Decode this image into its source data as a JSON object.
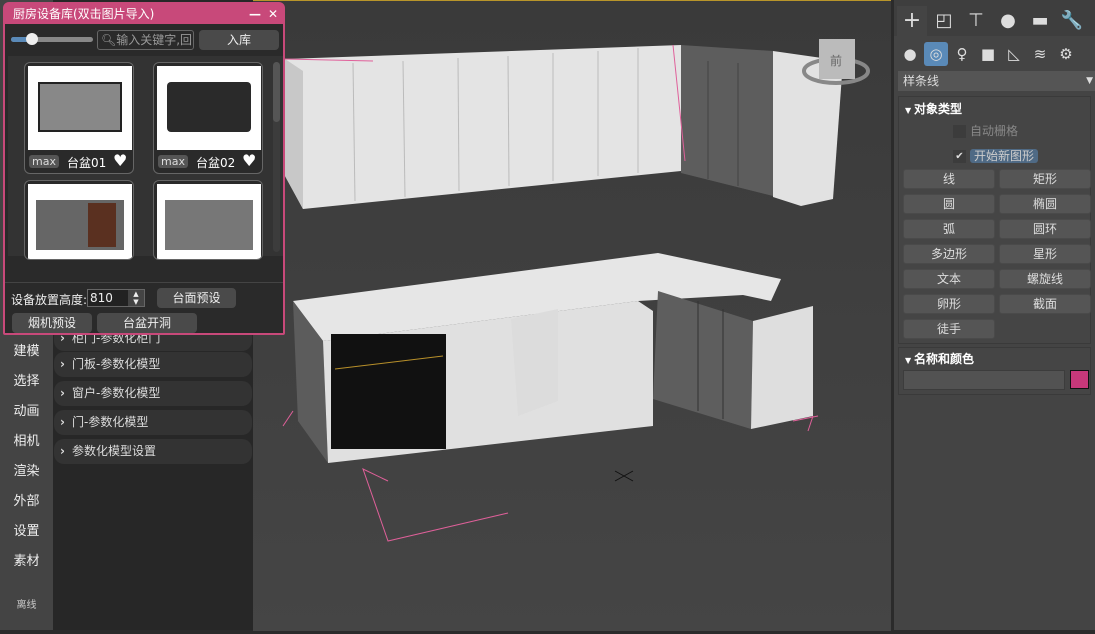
{
  "dialog": {
    "title": "厨房设备库(双击图片导入)",
    "search_placeholder": "输入关键字,回",
    "import_label": "入库",
    "zoom_slider": 0.25,
    "items": [
      {
        "badge": "max",
        "name": "台盆01"
      },
      {
        "badge": "max",
        "name": "台盆02"
      },
      {
        "badge": "",
        "name": ""
      },
      {
        "badge": "",
        "name": ""
      }
    ],
    "height_label": "设备放置高度:",
    "height_value": "810",
    "countertop_preset": "台面预设",
    "hood_preset": "烟机预设",
    "sink_cutout": "台盆开洞"
  },
  "leftbar": {
    "items": [
      "建模",
      "选择",
      "动画",
      "相机",
      "渲染",
      "外部",
      "设置",
      "素材"
    ],
    "status": "离线"
  },
  "plugin": {
    "sections": [
      "柜门-参数化柜门",
      "门板-参数化模型",
      "窗户-参数化模型",
      "门-参数化模型",
      "参数化模型设置"
    ]
  },
  "viewport": {
    "viewcube_label": "前"
  },
  "right": {
    "tabs": [
      "create",
      "modify",
      "hierarchy",
      "motion",
      "display",
      "utilities"
    ],
    "subtabs": [
      "geometry",
      "shapes",
      "lights",
      "cameras",
      "helpers",
      "space-warps",
      "systems"
    ],
    "category": "样条线",
    "object_type": {
      "title": "对象类型",
      "autogrid": "自动栅格",
      "start_new_shape": "开始新图形",
      "start_new_checked": true,
      "buttons": [
        "线",
        "矩形",
        "圆",
        "椭圆",
        "弧",
        "圆环",
        "多边形",
        "星形",
        "文本",
        "螺旋线",
        "卵形",
        "截面",
        "徒手"
      ]
    },
    "name_color": {
      "title": "名称和颜色",
      "name_value": "",
      "color": "#c8387a"
    }
  },
  "colors": {
    "accent": "#c8497a",
    "active_tab": "#5a8ab8",
    "frame": "#b8952a"
  }
}
